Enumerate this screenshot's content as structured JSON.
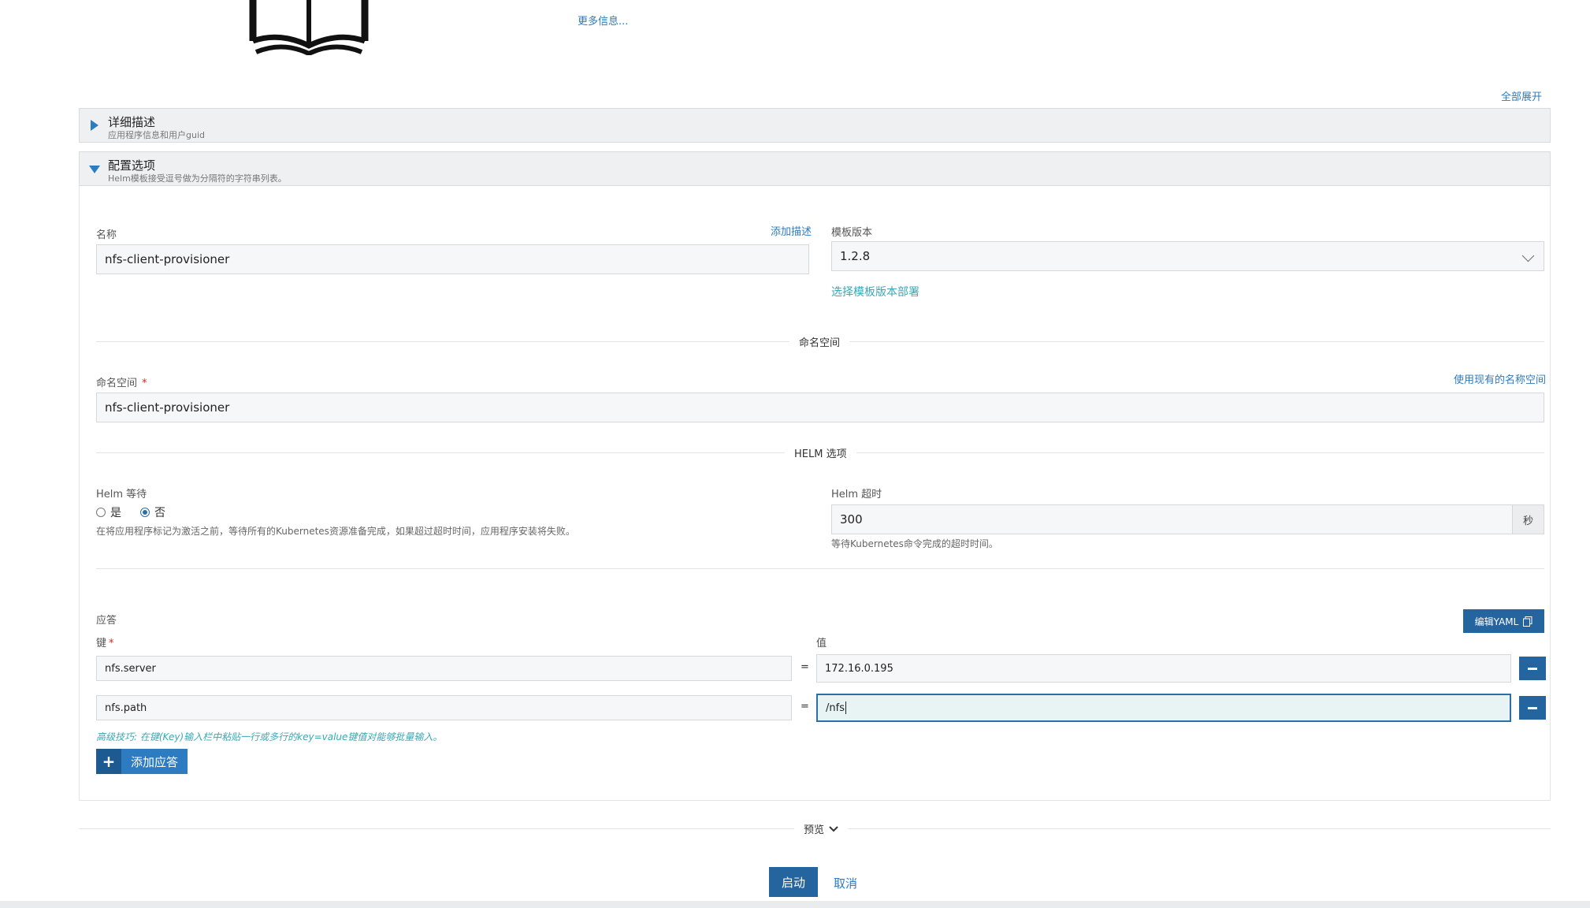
{
  "header": {
    "more_info": "更多信息...",
    "expand_all": "全部展开"
  },
  "sections": {
    "details": {
      "title": "详细描述",
      "subtitle": "应用程序信息和用户guid"
    },
    "config": {
      "title": "配置选项",
      "subtitle": "Helm模板接受逗号做为分隔符的字符串列表。"
    }
  },
  "form": {
    "name_label": "名称",
    "add_description": "添加描述",
    "name_value": "nfs-client-provisioner",
    "template_version_label": "模板版本",
    "template_version_value": "1.2.8",
    "select_template_link": "选择模板版本部署",
    "namespace_divider": "命名空间",
    "namespace_label": "命名空间",
    "use_existing_namespace": "使用现有的名称空间",
    "namespace_value": "nfs-client-provisioner",
    "helm_divider": "HELM 选项",
    "helm_wait_label": "Helm 等待",
    "helm_wait_yes": "是",
    "helm_wait_no": "否",
    "helm_wait_selected": "否",
    "helm_wait_help": "在将应用程序标记为激活之前，等待所有的Kubernetes资源准备完成，如果超过超时时间，应用程序安装将失败。",
    "helm_timeout_label": "Helm 超时",
    "helm_timeout_value": "300",
    "helm_timeout_unit": "秒",
    "helm_timeout_help": "等待Kubernetes命令完成的超时时间。"
  },
  "answers": {
    "title": "应答",
    "edit_yaml": "编辑YAML",
    "key_label": "键",
    "value_label": "值",
    "equals": "=",
    "rows": [
      {
        "key": "nfs.server",
        "value": "172.16.0.195"
      },
      {
        "key": "nfs.path",
        "value": "/nfs"
      }
    ],
    "tip": "高级技巧: 在键(Key)输入栏中粘贴一行或多行的key=value键值对能够批量输入。",
    "add_answer": "添加应答"
  },
  "footer": {
    "preview": "预览",
    "launch": "启动",
    "cancel": "取消"
  },
  "colors": {
    "primary": "#2465a0",
    "link": "#2d7bc0",
    "tip": "#3aa8b6",
    "required": "#dd2222"
  }
}
